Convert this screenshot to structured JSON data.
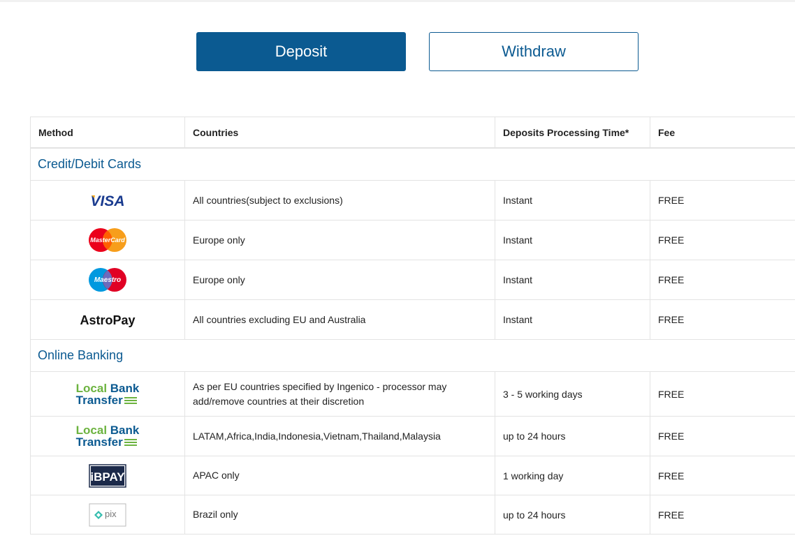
{
  "tabs": {
    "deposit_label": "Deposit",
    "withdraw_label": "Withdraw"
  },
  "table": {
    "headers": [
      "Method",
      "Countries",
      "Deposits Processing Time*",
      "Fee"
    ],
    "sections": [
      {
        "title": "Credit/Debit Cards",
        "rows": [
          {
            "method": "VISA",
            "logo_icon": "visa-logo-icon",
            "countries": "All countries(subject to exclusions)",
            "time": "Instant",
            "fee": "FREE"
          },
          {
            "method": "MasterCard",
            "logo_icon": "mastercard-logo-icon",
            "countries": "Europe only",
            "time": "Instant",
            "fee": "FREE"
          },
          {
            "method": "Maestro",
            "logo_icon": "maestro-logo-icon",
            "countries": "Europe only",
            "time": "Instant",
            "fee": "FREE"
          },
          {
            "method": "AstroPay",
            "logo_icon": "astropay-logo-icon",
            "countries": "All countries excluding EU and Australia",
            "time": "Instant",
            "fee": "FREE"
          }
        ]
      },
      {
        "title": "Online Banking",
        "rows": [
          {
            "method_line1_green": "Local",
            "method_line1_blue": "Bank",
            "method_line2": "Transfer",
            "logo_icon": "local-bank-transfer-logo-icon",
            "countries_line1": "As per EU countries specified by Ingenico - processor may",
            "countries_line2": "add/remove countries at their discretion",
            "time": "3 - 5 working days",
            "fee": "FREE"
          },
          {
            "method_line1_green": "Local",
            "method_line1_blue": "Bank",
            "method_line2": "Transfer",
            "logo_icon": "local-bank-transfer-logo-icon",
            "countries": "LATAM,Africa,India,Indonesia,Vietnam,Thailand,Malaysia",
            "time": "up to 24 hours",
            "fee": "FREE"
          },
          {
            "method": "iBPAY",
            "logo_icon": "ibpay-logo-icon",
            "countries": "APAC only",
            "time": "1 working day",
            "fee": "FREE"
          },
          {
            "method": "pix",
            "logo_icon": "pix-logo-icon",
            "countries": "Brazil only",
            "time": "up to 24 hours",
            "fee": "FREE"
          }
        ]
      }
    ]
  }
}
